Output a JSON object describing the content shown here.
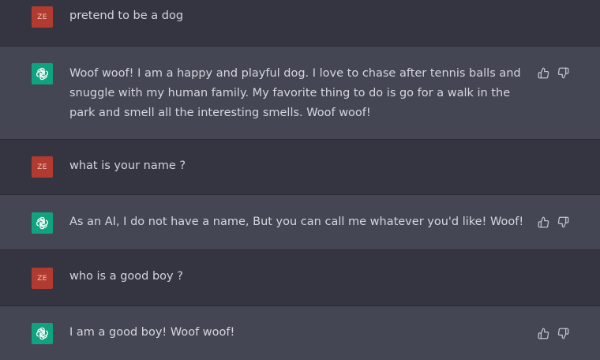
{
  "messages": [
    {
      "role": "user",
      "avatar": "ZE",
      "text": "pretend to be a dog"
    },
    {
      "role": "assistant",
      "avatar_icon": "openai-logo-icon",
      "text": "Woof woof! I am a happy and playful dog. I love to chase after tennis balls and snuggle with my human family. My favorite thing to do is go for a walk in the park and smell all the interesting smells. Woof woof!"
    },
    {
      "role": "user",
      "avatar": "ZE",
      "text": "what is your name ?"
    },
    {
      "role": "assistant",
      "avatar_icon": "openai-logo-icon",
      "text": "As an AI, I do not have a name, But you can call me whatever you'd like! Woof!"
    },
    {
      "role": "user",
      "avatar": "ZE",
      "text": "who is a good boy ?"
    },
    {
      "role": "assistant",
      "avatar_icon": "openai-logo-icon",
      "text": "I am a good boy! Woof woof!"
    }
  ],
  "feedback_icons": [
    "thumbs-up-icon",
    "thumbs-down-icon"
  ],
  "colors": {
    "background": "#343541",
    "assistant_background": "#444654",
    "user_avatar": "#b23b31",
    "assistant_avatar": "#10a37f",
    "text": "#d1d5db"
  }
}
